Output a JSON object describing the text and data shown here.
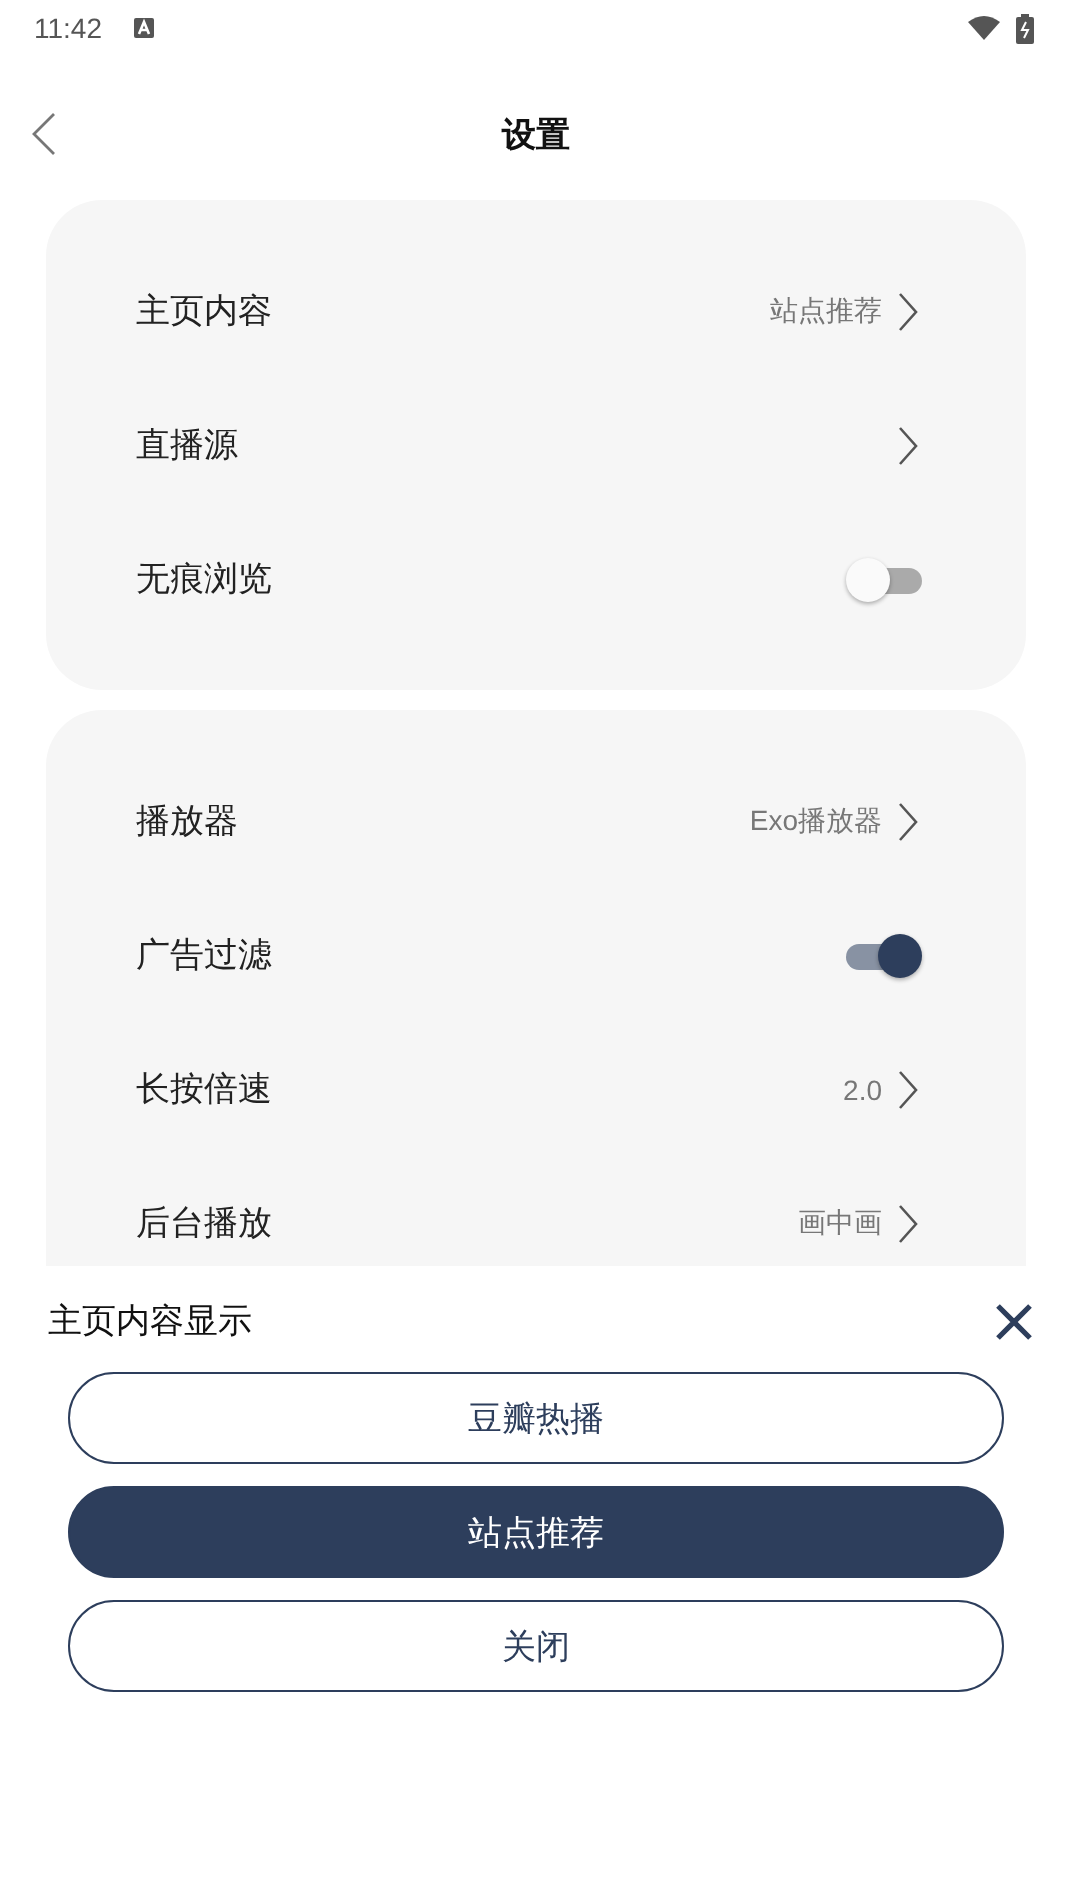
{
  "status_bar": {
    "time": "11:42"
  },
  "header": {
    "title": "设置"
  },
  "groups": [
    {
      "rows": [
        {
          "kind": "nav",
          "label": "主页内容",
          "value": "站点推荐"
        },
        {
          "kind": "nav",
          "label": "直播源"
        },
        {
          "kind": "toggle",
          "label": "无痕浏览",
          "on": false
        }
      ]
    },
    {
      "rows": [
        {
          "kind": "nav",
          "label": "播放器",
          "value": "Exo播放器"
        },
        {
          "kind": "toggle",
          "label": "广告过滤",
          "on": true
        },
        {
          "kind": "nav",
          "label": "长按倍速",
          "value": "2.0"
        },
        {
          "kind": "nav",
          "label": "后台播放",
          "value": "画中画"
        }
      ]
    }
  ],
  "sheet": {
    "title": "主页内容显示",
    "options": [
      {
        "label": "豆瓣热播",
        "selected": false
      },
      {
        "label": "站点推荐",
        "selected": true
      }
    ],
    "close_label": "关闭"
  }
}
